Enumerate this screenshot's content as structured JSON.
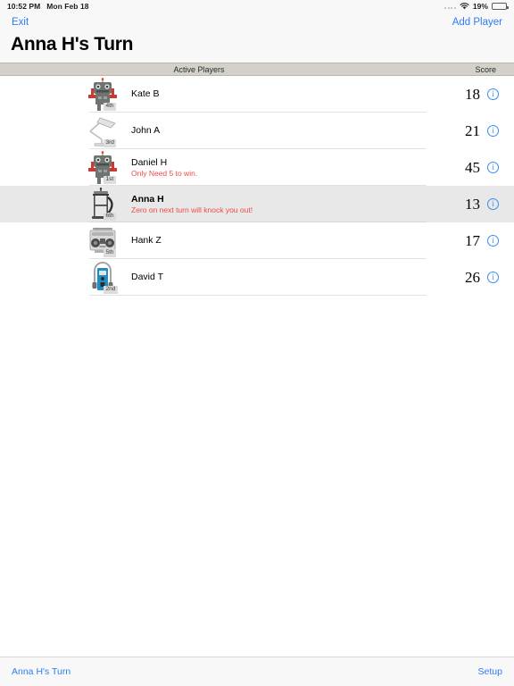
{
  "status_bar": {
    "time": "10:52 PM",
    "date": "Mon Feb 18",
    "battery_percent": "19%",
    "battery_level": 19,
    "wifi_icon": "wifi-icon",
    "signal_icon": "signal-dots-icon",
    "battery_icon": "battery-icon"
  },
  "nav": {
    "left_label": "Exit",
    "right_label": "Add Player"
  },
  "header": {
    "title": "Anna H's Turn"
  },
  "table_header": {
    "players_column": "Active Players",
    "score_column": "Score"
  },
  "colors": {
    "accent_blue": "#2e7cf6",
    "info_blue": "#3b8cf0",
    "warning_red": "#ef4b4b",
    "section_header_bg": "#d3d1ca",
    "current_row_bg": "#e8e8e8"
  },
  "players": [
    {
      "name": "Kate B",
      "note": "",
      "score": "18",
      "rank": "4th",
      "avatar": "robot-avatar",
      "current": false,
      "info_icon": "info-icon"
    },
    {
      "name": "John A",
      "note": "",
      "score": "21",
      "rank": "3rd",
      "avatar": "desk-lamp-avatar",
      "current": false,
      "info_icon": "info-icon"
    },
    {
      "name": "Daniel H",
      "note": "Only Need 5 to win.",
      "score": "45",
      "rank": "1st",
      "avatar": "robot-avatar",
      "current": false,
      "info_icon": "info-icon"
    },
    {
      "name": "Anna H",
      "note": "Zero on next turn will knock you out!",
      "score": "13",
      "rank": "6th",
      "avatar": "french-press-avatar",
      "current": true,
      "info_icon": "info-icon"
    },
    {
      "name": "Hank Z",
      "note": "",
      "score": "17",
      "rank": "5th",
      "avatar": "boombox-avatar",
      "current": false,
      "info_icon": "info-icon"
    },
    {
      "name": "David T",
      "note": "",
      "score": "26",
      "rank": "2nd",
      "avatar": "walkman-avatar",
      "current": false,
      "info_icon": "info-icon"
    }
  ],
  "toolbar": {
    "left_label": "Anna H's Turn",
    "right_label": "Setup"
  }
}
